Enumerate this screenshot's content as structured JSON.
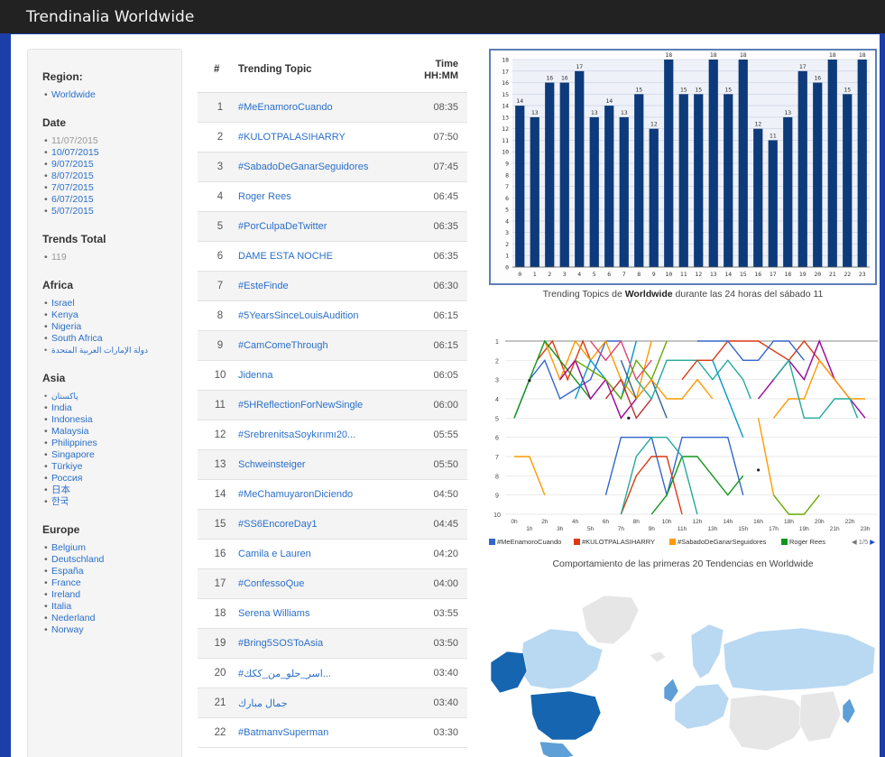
{
  "header": {
    "title": "Trendinalia Worldwide"
  },
  "sidebar": {
    "region_heading": "Region:",
    "region_items": [
      "Worldwide"
    ],
    "date_heading": "Date",
    "date_items": [
      "11/07/2015",
      "10/07/2015",
      "9/07/2015",
      "8/07/2015",
      "7/07/2015",
      "6/07/2015",
      "5/07/2015"
    ],
    "trends_heading": "Trends Total",
    "trends_total": "119",
    "africa_heading": "Africa",
    "africa_items": [
      "Israel",
      "Kenya",
      "Nigeria",
      "South Africa",
      "دولة الإمارات العربية المتحدة"
    ],
    "asia_heading": "Asia",
    "asia_items": [
      "پاکستان",
      "India",
      "Indonesia",
      "Malaysia",
      "Philippines",
      "Singapore",
      "Türkiye",
      "Россия",
      "日本",
      "한국"
    ],
    "europe_heading": "Europe",
    "europe_items": [
      "Belgium",
      "Deutschland",
      "España",
      "France",
      "Ireland",
      "Italia",
      "Nederland",
      "Norway"
    ]
  },
  "table": {
    "col_num": "#",
    "col_topic": "Trending Topic",
    "col_time_1": "Time",
    "col_time_2": "HH:MM",
    "rows": [
      {
        "n": "1",
        "topic": "#MeEnamoroCuando",
        "time": "08:35"
      },
      {
        "n": "2",
        "topic": "#KULOTPALASIHARRY",
        "time": "07:50"
      },
      {
        "n": "3",
        "topic": "#SabadoDeGanarSeguidores",
        "time": "07:45"
      },
      {
        "n": "4",
        "topic": "Roger Rees",
        "time": "06:45"
      },
      {
        "n": "5",
        "topic": "#PorCulpaDeTwitter",
        "time": "06:35"
      },
      {
        "n": "6",
        "topic": "DAME ESTA NOCHE",
        "time": "06:35"
      },
      {
        "n": "7",
        "topic": "#EsteFinde",
        "time": "06:30"
      },
      {
        "n": "8",
        "topic": "#5YearsSinceLouisAudition",
        "time": "06:15"
      },
      {
        "n": "9",
        "topic": "#CamComeThrough",
        "time": "06:15"
      },
      {
        "n": "10",
        "topic": "Jidenna",
        "time": "06:05"
      },
      {
        "n": "11",
        "topic": "#5HReflectionForNewSingle",
        "time": "06:00"
      },
      {
        "n": "12",
        "topic": "#SrebrenitsaSoykırımı20...",
        "time": "05:55"
      },
      {
        "n": "13",
        "topic": "Schweinsteiger",
        "time": "05:50"
      },
      {
        "n": "14",
        "topic": "#MeChamuyaronDiciendo",
        "time": "04:50"
      },
      {
        "n": "15",
        "topic": "#SS6EncoreDay1",
        "time": "04:45"
      },
      {
        "n": "16",
        "topic": "Camila e Lauren",
        "time": "04:20"
      },
      {
        "n": "17",
        "topic": "#ConfessoQue",
        "time": "04:00"
      },
      {
        "n": "18",
        "topic": "Serena Williams",
        "time": "03:55"
      },
      {
        "n": "19",
        "topic": "#Bring5SOSToAsia",
        "time": "03:50"
      },
      {
        "n": "20",
        "topic": "#اسر_حلو_من_ككك...",
        "time": "03:40"
      },
      {
        "n": "21",
        "topic": "جمال مبارك",
        "time": "03:40"
      },
      {
        "n": "22",
        "topic": "#BatmanvSuperman",
        "time": "03:30"
      }
    ]
  },
  "bar_chart": {
    "caption_prefix": "Trending Topics de ",
    "caption_bold": "Worldwide",
    "caption_suffix": " durante las 24 horas del sábado 11",
    "bar_color": "#0d3a7a",
    "chart_data": {
      "type": "bar",
      "categories": [
        "0",
        "1",
        "2",
        "3",
        "4",
        "5",
        "6",
        "7",
        "8",
        "9",
        "10",
        "11",
        "12",
        "13",
        "14",
        "15",
        "16",
        "17",
        "18",
        "19",
        "20",
        "21",
        "22",
        "23"
      ],
      "values": [
        14,
        13,
        16,
        16,
        17,
        13,
        14,
        13,
        15,
        12,
        18,
        15,
        15,
        18,
        15,
        18,
        12,
        11,
        13,
        17,
        16,
        18,
        15,
        18
      ],
      "ylim": [
        0,
        18
      ],
      "yticks": [
        "0",
        "1",
        "2",
        "3",
        "4",
        "5",
        "6",
        "7",
        "8",
        "9",
        "10",
        "11",
        "12",
        "13",
        "14",
        "15",
        "16",
        "17",
        "18"
      ]
    }
  },
  "line_chart": {
    "caption": "Comportamiento de las primeras 20 Tendencias en Worldwide",
    "y_ticks": [
      "1",
      "2",
      "3",
      "4",
      "5",
      "6",
      "7",
      "8",
      "9",
      "10"
    ],
    "x_ticks_top": [
      "0h",
      "2h",
      "4h",
      "6h",
      "8h",
      "10h",
      "12h",
      "14h",
      "16h",
      "18h",
      "20h",
      "22h"
    ],
    "x_ticks_bottom": [
      "1h",
      "3h",
      "5h",
      "7h",
      "9h",
      "11h",
      "13h",
      "15h",
      "17h",
      "19h",
      "21h",
      "23h"
    ],
    "legend": [
      {
        "label": "#MeEnamoroCuando",
        "color": "#3366cc"
      },
      {
        "label": "#KULOTPALASIHARRY",
        "color": "#dc3912"
      },
      {
        "label": "#SabadoDeGanarSeguidores",
        "color": "#ff9900"
      },
      {
        "label": "Roger Rees",
        "color": "#109618"
      }
    ],
    "pager": "1/5"
  },
  "map": {
    "dark_color": "#1565b0",
    "mid_color": "#5d9fd6",
    "light_color": "#b9d8f2",
    "none_color": "#e6e6e6"
  }
}
